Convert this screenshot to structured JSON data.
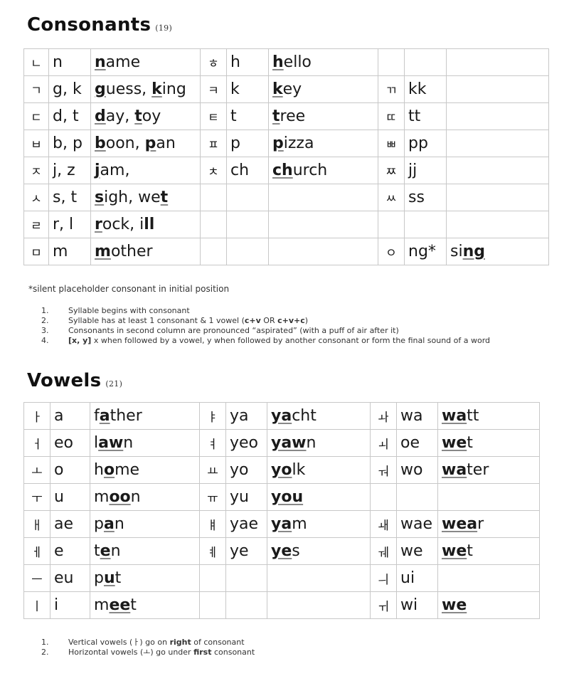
{
  "consonants": {
    "title": "Consonants",
    "count": "(19)",
    "rows": [
      [
        {
          "t": "ㄴ"
        },
        {
          "t": "n"
        },
        {
          "h": "<span class='u'>n</span>ame"
        },
        {
          "t": "ㅎ"
        },
        {
          "t": "h"
        },
        {
          "h": "<span class='u'>h</span>ello"
        },
        {
          "t": ""
        },
        {
          "t": ""
        },
        {
          "t": ""
        }
      ],
      [
        {
          "t": "ㄱ"
        },
        {
          "t": "g, k"
        },
        {
          "h": "<span class='u'>g</span>uess, <span class='u'>k</span>ing"
        },
        {
          "t": "ㅋ"
        },
        {
          "t": "k"
        },
        {
          "h": "<span class='u'>k</span>ey"
        },
        {
          "t": "ㄲ"
        },
        {
          "t": "kk"
        },
        {
          "t": ""
        }
      ],
      [
        {
          "t": "ㄷ"
        },
        {
          "t": "d, t"
        },
        {
          "h": "<span class='u'>d</span>ay, <span class='u'>t</span>oy"
        },
        {
          "t": "ㅌ"
        },
        {
          "t": "t"
        },
        {
          "h": "<span class='u'>t</span>ree"
        },
        {
          "t": "ㄸ"
        },
        {
          "t": "tt"
        },
        {
          "t": ""
        }
      ],
      [
        {
          "t": "ㅂ"
        },
        {
          "t": "b, p"
        },
        {
          "h": "<span class='u'>b</span>oon, <span class='u'>p</span>an"
        },
        {
          "t": "ㅍ"
        },
        {
          "t": "p"
        },
        {
          "h": "<span class='u'>p</span>izza"
        },
        {
          "t": "ㅃ"
        },
        {
          "t": "pp"
        },
        {
          "t": ""
        }
      ],
      [
        {
          "t": "ㅈ"
        },
        {
          "t": "j, z"
        },
        {
          "h": "<span class='u'>j</span>am,"
        },
        {
          "t": "ㅊ"
        },
        {
          "t": "ch"
        },
        {
          "h": "<span class='u'>ch</span>urch"
        },
        {
          "t": "ㅉ"
        },
        {
          "t": "jj"
        },
        {
          "t": ""
        }
      ],
      [
        {
          "t": "ㅅ"
        },
        {
          "t": "s, t"
        },
        {
          "h": "<span class='u'>s</span>igh, we<span class='u'>t</span>"
        },
        {
          "t": ""
        },
        {
          "t": ""
        },
        {
          "t": ""
        },
        {
          "t": "ㅆ"
        },
        {
          "t": "ss"
        },
        {
          "t": ""
        }
      ],
      [
        {
          "t": "ㄹ"
        },
        {
          "t": "r, l"
        },
        {
          "h": "<span class='u'>r</span>ock, i<b>ll</b>"
        },
        {
          "t": ""
        },
        {
          "t": ""
        },
        {
          "t": ""
        },
        {
          "t": ""
        },
        {
          "t": ""
        },
        {
          "t": ""
        }
      ],
      [
        {
          "t": "ㅁ"
        },
        {
          "t": "m"
        },
        {
          "h": "<span class='u'>m</span>other"
        },
        {
          "t": ""
        },
        {
          "t": ""
        },
        {
          "t": ""
        },
        {
          "t": "ㅇ"
        },
        {
          "t": "ng*"
        },
        {
          "h": "si<span class='u'>ng</span>"
        }
      ]
    ],
    "footnote": "*silent placeholder consonant in initial position",
    "notes": [
      {
        "num": "1.",
        "h": "Syllable begins with consonant"
      },
      {
        "num": "2.",
        "h": "Syllable has at least 1 consonant &amp; 1 vowel (<b>c+v</b> OR <b>c+v+c</b>)"
      },
      {
        "num": "3.",
        "h": "Consonants in second column are pronounced “aspirated” (with a puff of air after it)"
      },
      {
        "num": "4.",
        "h": "<b>[x, y]</b> x when followed by a vowel, y when followed by another consonant or form the final sound of a word"
      }
    ]
  },
  "vowels": {
    "title": "Vowels",
    "count": "(21)",
    "rows": [
      [
        {
          "t": "ㅏ"
        },
        {
          "t": "a"
        },
        {
          "h": "f<span class='u'>a</span>ther"
        },
        {
          "t": "ㅑ"
        },
        {
          "t": "ya"
        },
        {
          "h": "<span class='u'>ya</span>cht"
        },
        {
          "t": "ㅘ"
        },
        {
          "t": "wa"
        },
        {
          "h": "<span class='u'>wa</span>tt"
        }
      ],
      [
        {
          "t": "ㅓ"
        },
        {
          "t": "eo"
        },
        {
          "h": "l<span class='u'>aw</span>n"
        },
        {
          "t": "ㅕ"
        },
        {
          "t": "yeo"
        },
        {
          "h": "<span class='u'>yaw</span>n"
        },
        {
          "t": "ㅚ"
        },
        {
          "t": "oe"
        },
        {
          "h": "<span class='u'>we</span>t"
        }
      ],
      [
        {
          "t": "ㅗ"
        },
        {
          "t": "o"
        },
        {
          "h": "h<span class='u'>o</span>me"
        },
        {
          "t": "ㅛ"
        },
        {
          "t": "yo"
        },
        {
          "h": "<span class='u'>yo</span>lk"
        },
        {
          "t": "ㅝ"
        },
        {
          "t": "wo"
        },
        {
          "h": "<span class='u'>wa</span>ter"
        }
      ],
      [
        {
          "t": "ㅜ"
        },
        {
          "t": "u"
        },
        {
          "h": "m<span class='u'>oo</span>n"
        },
        {
          "t": "ㅠ"
        },
        {
          "t": "yu"
        },
        {
          "h": "<span class='u'>you</span>"
        },
        {
          "t": ""
        },
        {
          "t": ""
        },
        {
          "t": ""
        }
      ],
      [
        {
          "t": "ㅐ"
        },
        {
          "t": "ae"
        },
        {
          "h": "p<span class='u'>a</span>n"
        },
        {
          "t": "ㅒ"
        },
        {
          "t": "yae"
        },
        {
          "h": "<span class='u'>ya</span>m"
        },
        {
          "t": "ㅙ"
        },
        {
          "t": "wae"
        },
        {
          "h": "<span class='u'>wea</span>r"
        }
      ],
      [
        {
          "t": "ㅔ"
        },
        {
          "t": "e"
        },
        {
          "h": "t<span class='u'>e</span>n"
        },
        {
          "t": "ㅖ"
        },
        {
          "t": "ye"
        },
        {
          "h": "<span class='u'>ye</span>s"
        },
        {
          "t": "ㅞ"
        },
        {
          "t": "we"
        },
        {
          "h": "<span class='u'>we</span>t"
        }
      ],
      [
        {
          "t": "ㅡ"
        },
        {
          "t": "eu"
        },
        {
          "h": "p<span class='u'>u</span>t"
        },
        {
          "t": ""
        },
        {
          "t": ""
        },
        {
          "t": ""
        },
        {
          "t": "ㅢ"
        },
        {
          "t": "ui"
        },
        {
          "t": ""
        }
      ],
      [
        {
          "t": "ㅣ"
        },
        {
          "t": "i"
        },
        {
          "h": "m<span class='u'>ee</span>t"
        },
        {
          "t": ""
        },
        {
          "t": ""
        },
        {
          "t": ""
        },
        {
          "t": "ㅟ"
        },
        {
          "t": "wi"
        },
        {
          "h": "<span class='u'>we</span>"
        }
      ]
    ],
    "notes": [
      {
        "num": "1.",
        "h": "Vertical vowels (ㅏ) go on <b>right</b> of consonant"
      },
      {
        "num": "2.",
        "h": "Horizontal vowels (ㅗ) go under <b>first</b> consonant"
      }
    ]
  }
}
